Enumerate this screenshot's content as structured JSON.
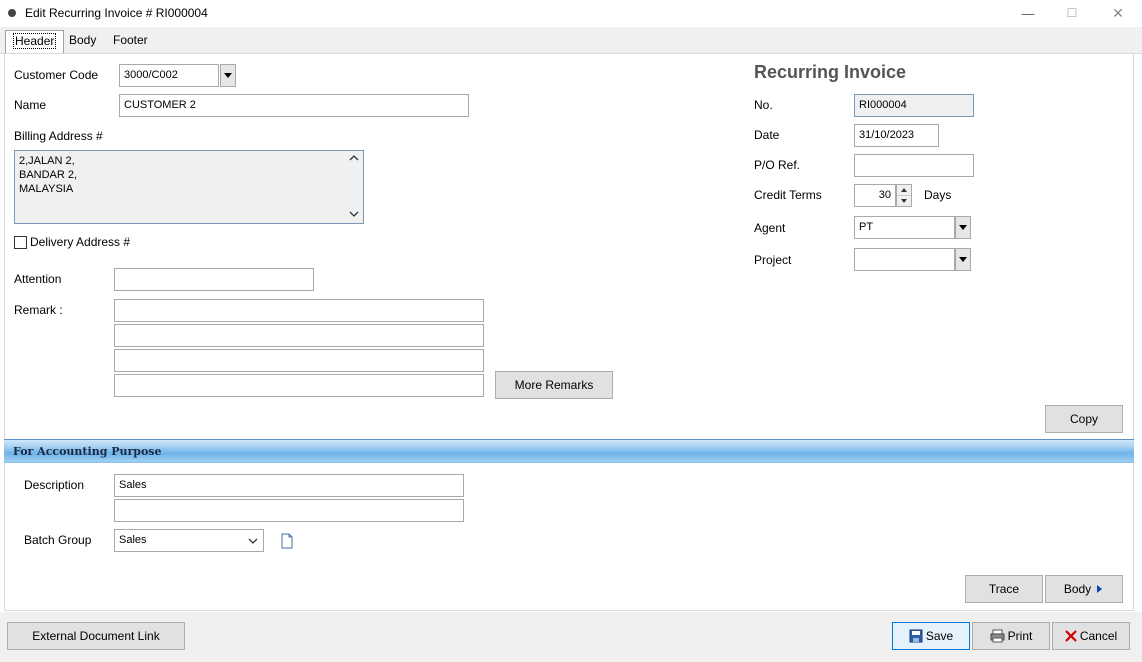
{
  "window": {
    "title": "Edit Recurring Invoice # RI000004",
    "minimize": "—",
    "maximize": "☐",
    "close": "✕"
  },
  "tabs": [
    {
      "label": "Header"
    },
    {
      "label": "Body"
    },
    {
      "label": "Footer"
    }
  ],
  "customer": {
    "code_label": "Customer Code",
    "code_value": "3000/C002",
    "name_label": "Name",
    "name_value": "CUSTOMER 2",
    "billing_label": "Billing Address #",
    "billing_lines": [
      "2,JALAN 2,",
      "BANDAR 2,",
      "MALAYSIA"
    ],
    "delivery_label": "Delivery Address #",
    "attention_label": "Attention",
    "attention_value": "",
    "remark_label": "Remark :",
    "remarks": [
      "",
      "",
      "",
      ""
    ],
    "more_remarks_label": "More Remarks"
  },
  "invoice": {
    "heading": "Recurring Invoice",
    "no_label": "No.",
    "no_value": "RI000004",
    "date_label": "Date",
    "date_value": "31/10/2023",
    "po_label": "P/O Ref.",
    "po_value": "",
    "terms_label": "Credit Terms",
    "terms_value": "30",
    "terms_unit": "Days",
    "agent_label": "Agent",
    "agent_value": "PT",
    "project_label": "Project",
    "project_value": "",
    "copy_label": "Copy"
  },
  "accounting": {
    "section_title": "For Accounting Purpose",
    "description_label": "Description",
    "description_value": "Sales",
    "description_value2": "",
    "batch_label": "Batch Group",
    "batch_value": "Sales",
    "trace_label": "Trace",
    "body_label": "Body"
  },
  "footer": {
    "external_link_label": "External Document Link",
    "save_label": "Save",
    "print_label": "Print",
    "cancel_label": "Cancel"
  },
  "colors": {
    "accent": "#0078d7",
    "section_bar": "#6fb3ea",
    "cancel_icon": "#d00000"
  }
}
